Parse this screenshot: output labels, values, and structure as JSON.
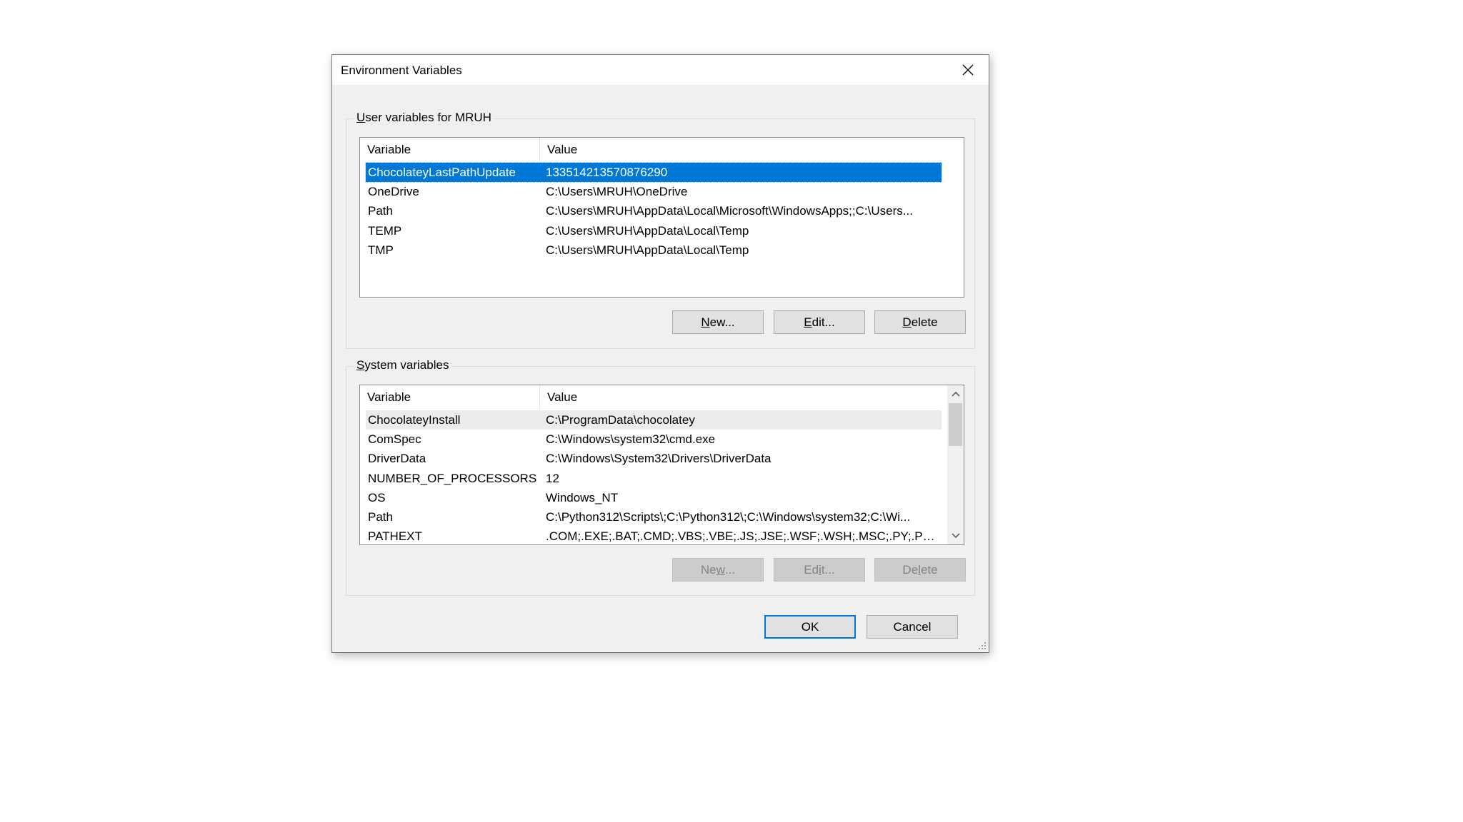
{
  "dialog": {
    "title": "Environment Variables"
  },
  "user_vars": {
    "legend_prefix": "U",
    "legend_rest": "ser variables for MRUH",
    "columns": {
      "variable": "Variable",
      "value": "Value"
    },
    "rows": [
      {
        "name": "ChocolateyLastPathUpdate",
        "value": "133514213570876290"
      },
      {
        "name": "OneDrive",
        "value": "C:\\Users\\MRUH\\OneDrive"
      },
      {
        "name": "Path",
        "value": "C:\\Users\\MRUH\\AppData\\Local\\Microsoft\\WindowsApps;;C:\\Users..."
      },
      {
        "name": "TEMP",
        "value": "C:\\Users\\MRUH\\AppData\\Local\\Temp"
      },
      {
        "name": "TMP",
        "value": "C:\\Users\\MRUH\\AppData\\Local\\Temp"
      }
    ],
    "buttons": {
      "new_u": "N",
      "new_rest": "ew...",
      "edit_u": "E",
      "edit_rest": "dit...",
      "delete_u": "D",
      "delete_rest": "elete"
    }
  },
  "system_vars": {
    "legend_prefix": "S",
    "legend_rest": "ystem variables",
    "columns": {
      "variable": "Variable",
      "value": "Value"
    },
    "rows": [
      {
        "name": "ChocolateyInstall",
        "value": "C:\\ProgramData\\chocolatey"
      },
      {
        "name": "ComSpec",
        "value": "C:\\Windows\\system32\\cmd.exe"
      },
      {
        "name": "DriverData",
        "value": "C:\\Windows\\System32\\Drivers\\DriverData"
      },
      {
        "name": "NUMBER_OF_PROCESSORS",
        "value": "12"
      },
      {
        "name": "OS",
        "value": "Windows_NT"
      },
      {
        "name": "Path",
        "value": "C:\\Python312\\Scripts\\;C:\\Python312\\;C:\\Windows\\system32;C:\\Wi..."
      },
      {
        "name": "PATHEXT",
        "value": ".COM;.EXE;.BAT;.CMD;.VBS;.VBE;.JS;.JSE;.WSF;.WSH;.MSC;.PY;.PYW"
      }
    ],
    "buttons": {
      "new_u": "w",
      "new_pre": "Ne",
      "new_rest": "...",
      "edit_u": "i",
      "edit_pre": "Ed",
      "edit_rest": "t...",
      "delete_u": "l",
      "delete_pre": "De",
      "delete_rest": "ete"
    }
  },
  "footer": {
    "ok": "OK",
    "cancel": "Cancel"
  },
  "colors": {
    "selection": "#0078d7",
    "dialog_bg": "#f0f0f0",
    "default_button_border": "#0078d7"
  }
}
